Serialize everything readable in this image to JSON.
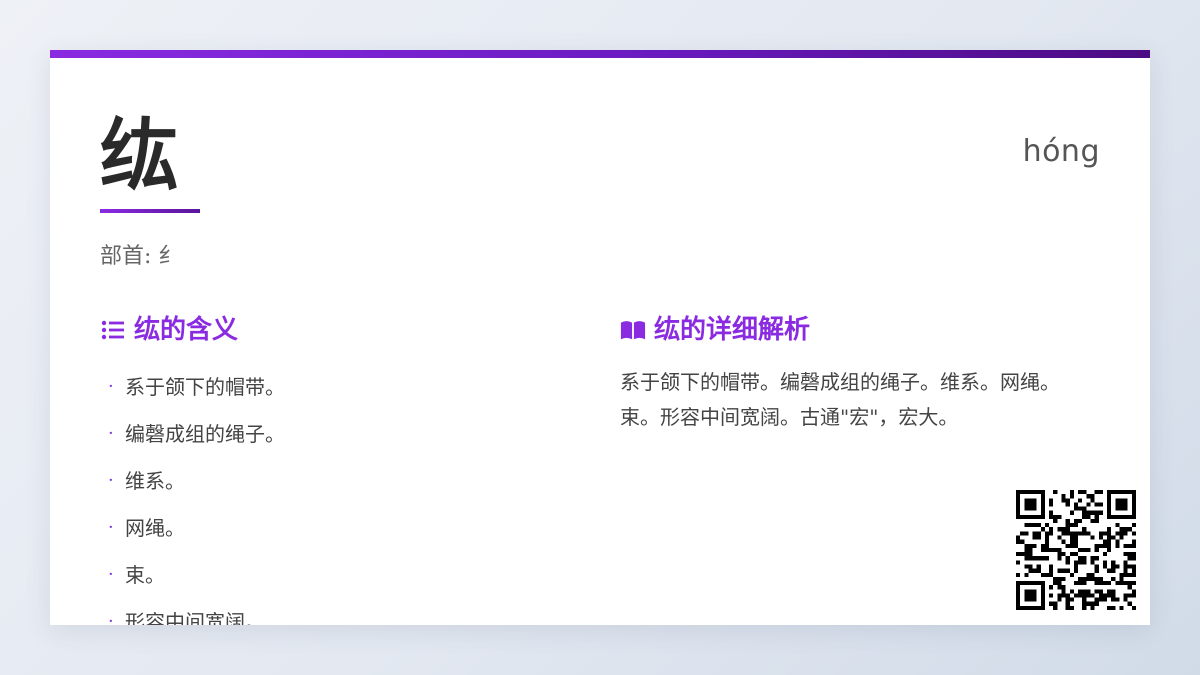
{
  "entry": {
    "character": "纮",
    "pinyin": "hóng",
    "radical_label": "部首: 纟"
  },
  "meanings": {
    "title": "纮的含义",
    "icon": "list-icon",
    "items": [
      "系于颌下的帽带。",
      "编磬成组的绳子。",
      "维系。",
      "网绳。",
      "束。",
      "形容中间宽阔。"
    ]
  },
  "analysis": {
    "title": "纮的详细解析",
    "icon": "book-icon",
    "text": "系于颌下的帽带。编磬成组的绳子。维系。网绳。束。形容中间宽阔。古通\"宏\"，宏大。"
  },
  "colors": {
    "accent": "#8a2be2",
    "accent_dark": "#4b0b82",
    "text": "#444444",
    "background": "#ffffff"
  },
  "qr": {
    "icon": "qr-code-icon"
  }
}
